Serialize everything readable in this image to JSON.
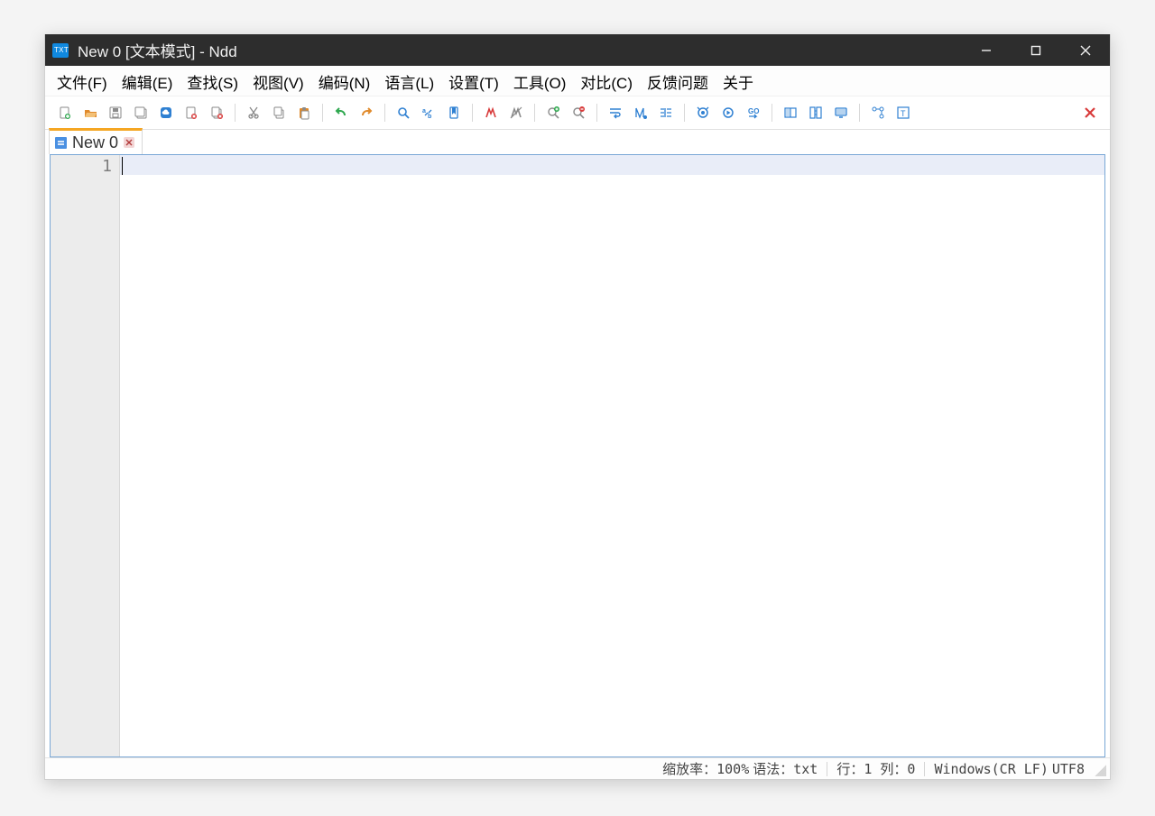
{
  "title": "New 0 [文本模式] - Ndd",
  "menus": [
    {
      "label": "文件(F)",
      "name": "menu-file"
    },
    {
      "label": "编辑(E)",
      "name": "menu-edit"
    },
    {
      "label": "查找(S)",
      "name": "menu-search"
    },
    {
      "label": "视图(V)",
      "name": "menu-view"
    },
    {
      "label": "编码(N)",
      "name": "menu-encoding"
    },
    {
      "label": "语言(L)",
      "name": "menu-language"
    },
    {
      "label": "设置(T)",
      "name": "menu-settings"
    },
    {
      "label": "工具(O)",
      "name": "menu-tools"
    },
    {
      "label": "对比(C)",
      "name": "menu-compare"
    },
    {
      "label": "反馈问题",
      "name": "menu-feedback"
    },
    {
      "label": "关于",
      "name": "menu-about"
    }
  ],
  "toolbar": {
    "groups": [
      [
        {
          "name": "new-file"
        },
        {
          "name": "open-file"
        },
        {
          "name": "save-file"
        },
        {
          "name": "save-all"
        },
        {
          "name": "cloud"
        },
        {
          "name": "close-file"
        },
        {
          "name": "close-all"
        }
      ],
      [
        {
          "name": "cut"
        },
        {
          "name": "copy"
        },
        {
          "name": "paste"
        }
      ],
      [
        {
          "name": "undo"
        },
        {
          "name": "redo"
        }
      ],
      [
        {
          "name": "find"
        },
        {
          "name": "replace"
        },
        {
          "name": "bookmark"
        }
      ],
      [
        {
          "name": "word-highlight"
        },
        {
          "name": "clear-highlight"
        }
      ],
      [
        {
          "name": "zoom-in"
        },
        {
          "name": "zoom-out"
        }
      ],
      [
        {
          "name": "word-wrap"
        },
        {
          "name": "show-whitespace"
        },
        {
          "name": "indent-guides"
        }
      ],
      [
        {
          "name": "macro-record"
        },
        {
          "name": "macro-play"
        },
        {
          "name": "goto"
        }
      ],
      [
        {
          "name": "split-view"
        },
        {
          "name": "file-compare"
        },
        {
          "name": "monitor-fullscreen"
        }
      ],
      [
        {
          "name": "hierarchy"
        },
        {
          "name": "text-panel"
        }
      ]
    ],
    "close_tool": {
      "name": "close-app-tool"
    }
  },
  "tab": {
    "label": "New 0"
  },
  "editor": {
    "first_line_no": "1",
    "content": ""
  },
  "status": {
    "zoom": "缩放率：100%",
    "syntax": "语法：txt",
    "position": "行：1 列：0",
    "eol": "Windows(CR LF)",
    "encoding": "UTF8"
  }
}
